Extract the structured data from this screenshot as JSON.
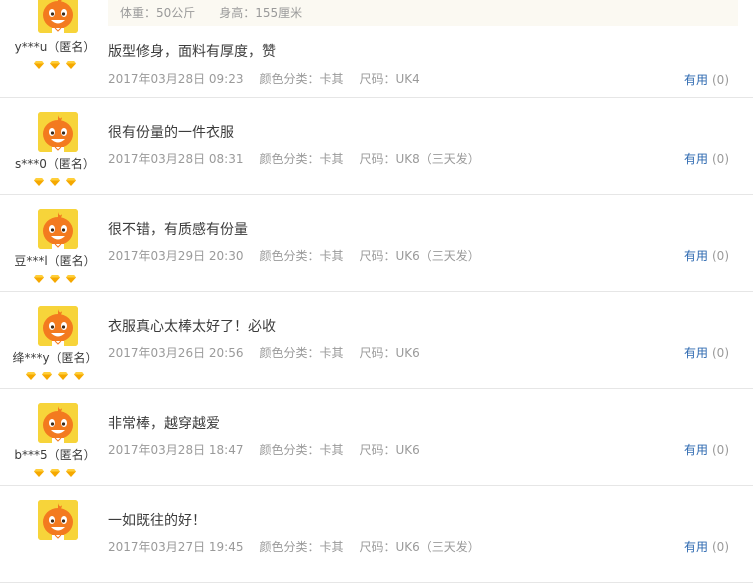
{
  "reviews": [
    {
      "nick": "y***u（匿名）",
      "level": 3,
      "info": [
        "体重：50公斤",
        "身高：155厘米"
      ],
      "text": "版型修身，面料有厚度，赞",
      "date": "2017年03月28日 09:23",
      "color": "颜色分类：卡其",
      "size": "尺码：UK4",
      "useful_label": "有用",
      "useful_count": "(0)"
    },
    {
      "nick": "s***0（匿名）",
      "level": 3,
      "text": "很有份量的一件衣服",
      "date": "2017年03月28日 08:31",
      "color": "颜色分类：卡其",
      "size": "尺码：UK8（三天发）",
      "useful_label": "有用",
      "useful_count": "(0)"
    },
    {
      "nick": "豆***l（匿名）",
      "level": 3,
      "text": "很不错，有质感有份量",
      "date": "2017年03月29日 20:30",
      "color": "颜色分类：卡其",
      "size": "尺码：UK6（三天发）",
      "useful_label": "有用",
      "useful_count": "(0)"
    },
    {
      "nick": "绛***y（匿名）",
      "level": 4,
      "text": "衣服真心太棒太好了！必收",
      "date": "2017年03月26日 20:56",
      "color": "颜色分类：卡其",
      "size": "尺码：UK6",
      "useful_label": "有用",
      "useful_count": "(0)"
    },
    {
      "nick": "b***5（匿名）",
      "level": 3,
      "text": "非常棒，越穿越爱",
      "date": "2017年03月28日 18:47",
      "color": "颜色分类：卡其",
      "size": "尺码：UK6",
      "useful_label": "有用",
      "useful_count": "(0)"
    },
    {
      "nick": "",
      "level": 0,
      "text": "一如既往的好！",
      "date": "2017年03月27日 19:45",
      "color": "颜色分类：卡其",
      "size": "尺码：UK6（三天发）",
      "useful_label": "有用",
      "useful_count": "(0)"
    }
  ],
  "colors": {
    "useful_link": "#2c68b0",
    "meta_text": "#9a9a9a",
    "gem": "#f5a800",
    "avatar_bg": "#f7d43a",
    "mascot": "#f37a1f"
  },
  "icons": {
    "avatar": "tmall-mascot-avatar-icon",
    "level": "diamond-icon"
  }
}
